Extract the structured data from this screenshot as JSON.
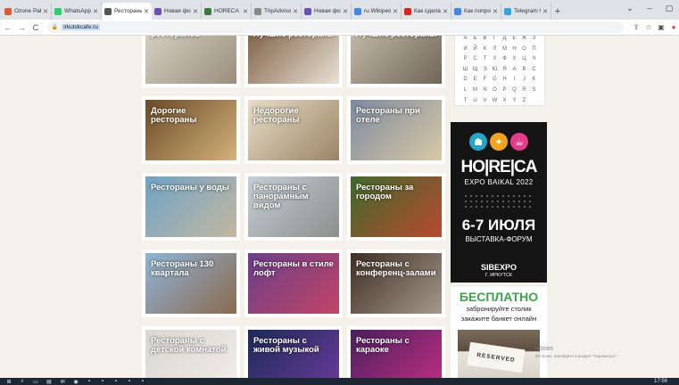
{
  "tabs": [
    {
      "label": "Ozone Pattern",
      "color": "#e05a2b",
      "active": false
    },
    {
      "label": "WhatsApp",
      "color": "#25d366",
      "active": false
    },
    {
      "label": "Рестораны Ир",
      "color": "#555555",
      "active": true
    },
    {
      "label": "Новая форма",
      "color": "#6b4fbb",
      "active": false
    },
    {
      "label": "HORECA · эксп",
      "color": "#3a7a3a",
      "active": false
    },
    {
      "label": "TripAdvisor",
      "color": "#888888",
      "active": false
    },
    {
      "label": "Новая форма",
      "color": "#6b4fbb",
      "active": false
    },
    {
      "label": "ru.Wikipedia",
      "color": "#4285f4",
      "active": false
    },
    {
      "label": "Как сделать",
      "color": "#e62117",
      "active": false
    },
    {
      "label": "Как попросить",
      "color": "#4285f4",
      "active": false
    },
    {
      "label": "Telegram Web",
      "color": "#2ca5e0",
      "active": false
    }
  ],
  "toolbar": {
    "url": "irkutskcafe.ru"
  },
  "cards": [
    {
      "title": "ресторанов",
      "c1": "#d9d2c3",
      "c2": "#9a8f7d",
      "col": 0,
      "row": 0
    },
    {
      "title": "Лучшие рестораны",
      "c1": "#7a5a3f",
      "c2": "#e9e2d5",
      "col": 1,
      "row": 0
    },
    {
      "title": "Лучшие рестораны",
      "c1": "#c8bfae",
      "c2": "#6f6555",
      "col": 2,
      "row": 0
    },
    {
      "title": "Дорогие рестораны",
      "c1": "#6b4a26",
      "c2": "#d3b27c",
      "col": 0,
      "row": 1
    },
    {
      "title": "Недорогие рестораны",
      "c1": "#e8dcc8",
      "c2": "#9b8566",
      "col": 1,
      "row": 1
    },
    {
      "title": "Рестораны при отеле",
      "c1": "#7c8aa0",
      "c2": "#d9c9a5",
      "col": 2,
      "row": 1
    },
    {
      "title": "Рестораны у воды",
      "c1": "#6ea3c8",
      "c2": "#c4b79f",
      "col": 0,
      "row": 2
    },
    {
      "title": "Рестораны с панорамным видом",
      "c1": "#c6cfd6",
      "c2": "#8c8f8c",
      "col": 1,
      "row": 2
    },
    {
      "title": "Рестораны за городом",
      "c1": "#3f6a2c",
      "c2": "#b84a2e",
      "col": 2,
      "row": 2
    },
    {
      "title": "Рестораны 130 квартала",
      "c1": "#8fb4d8",
      "c2": "#8a6a4e",
      "col": 0,
      "row": 3
    },
    {
      "title": "Рестораны в стиле лофт",
      "c1": "#6a3f8a",
      "c2": "#c24466",
      "col": 1,
      "row": 3
    },
    {
      "title": "Рестораны с конференц-залами",
      "c1": "#3e2e23",
      "c2": "#a49a8c",
      "col": 2,
      "row": 3
    },
    {
      "title": "Рестораны с детской комнатой",
      "c1": "#d9d6d3",
      "c2": "#f1ece6",
      "col": 0,
      "row": 4
    },
    {
      "title": "Рестораны с живой музыкой",
      "c1": "#1c2a57",
      "c2": "#6a3b9c",
      "col": 1,
      "row": 4
    },
    {
      "title": "Рестораны с караоке",
      "c1": "#4a1f5e",
      "c2": "#c12f82",
      "col": 2,
      "row": 4
    }
  ],
  "alphabet": [
    "А",
    "Б",
    "В",
    "Г",
    "Д",
    "Е",
    "Ж",
    "З",
    "И",
    "Й",
    "К",
    "Л",
    "М",
    "Н",
    "О",
    "П",
    "Р",
    "С",
    "Т",
    "У",
    "Ф",
    "Х",
    "Ц",
    "Ч",
    "Ш",
    "Щ",
    "Э",
    "Ю",
    "Я",
    "A",
    "B",
    "C",
    "D",
    "E",
    "F",
    "G",
    "H",
    "I",
    "J",
    "K",
    "L",
    "M",
    "N",
    "O",
    "P",
    "Q",
    "R",
    "S",
    "T",
    "U",
    "V",
    "W",
    "X",
    "Y",
    "Z"
  ],
  "banner1": {
    "title": "HO|RE|CA",
    "subtitle": "EXPO BAIKAL 2022",
    "date": "6-7 ИЮЛЯ",
    "format": "ВЫСТАВКА-ФОРУМ",
    "organizer": "SIBEXPO",
    "city": "Г. ИРКУТСК"
  },
  "banner2": {
    "title": "БЕСПЛАТНО",
    "line1": "забронируйте столик",
    "line2": "закажите банкет онлайн",
    "sign": "RESERVED"
  },
  "activate": {
    "line1": "ndows",
    "line2": "Windows, перейдите в раздел \"Параметры\"."
  },
  "taskbar": {
    "time": "17:56"
  }
}
